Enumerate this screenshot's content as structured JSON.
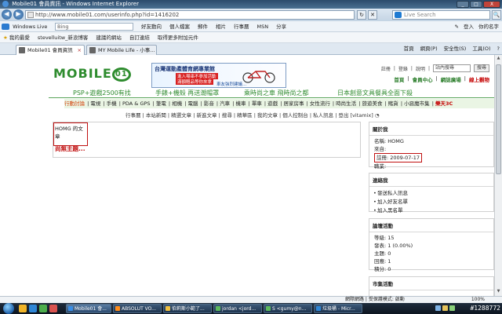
{
  "window": {
    "title": "Mobile01 會員資訊 - Windows Internet Explorer",
    "controls": [
      "_",
      "□",
      "X"
    ]
  },
  "address_bar": {
    "url": "http://www.mobile01.com/userinfo.php?id=1416202",
    "back": "◀",
    "forward": "▶",
    "refresh": "↻",
    "stop": "✕",
    "search_placeholder": "Live Search",
    "search_btn": "🔍"
  },
  "toolbar2": {
    "brand": "Windows Live",
    "bing": "Bing",
    "items": [
      "好友動向",
      "個人檔案",
      "郵件",
      "相片",
      "行事曆",
      "MSN",
      "分享"
    ],
    "right": [
      "✎",
      "登入",
      "你的名字"
    ]
  },
  "favorites": {
    "label": "我的最愛",
    "items": [
      "stevelluitw_新浪博客",
      "建議的網站",
      "自訂連結",
      "取得更多附加元件"
    ]
  },
  "tabs": [
    {
      "label": "Mobile01 會員資訊",
      "active": true
    },
    {
      "label": "MY Mobile Life - 小事...",
      "active": false
    }
  ],
  "tab_tools": [
    "首頁",
    "網頁(P)",
    "安全性(S)",
    "工具(O)",
    "?"
  ],
  "site": {
    "logo_text": "MOBILE",
    "logo_o1": "01",
    "banner": {
      "title": "台灣運動產體育網專業館",
      "red1": "進入場串不參加活動",
      "red2": "滿額贈品等你來拿",
      "blue": "車友強烈建議..."
    },
    "top_links": [
      "註冊",
      "登錄",
      "說明",
      "站內搜尋"
    ],
    "search_placeholder": "站內搜尋",
    "search_btn": "搜尋",
    "links2": [
      {
        "text": "首頁",
        "style": "grn"
      },
      {
        "text": "會員中心",
        "style": "grn"
      },
      {
        "text": "網誌廣場",
        "style": "grn"
      },
      {
        "text": "線上觀物",
        "style": "red"
      }
    ],
    "promos": [
      "PSP+遊戲2500有找",
      "手錶+機殼 再送潮帽罩",
      "乘時尚之車 飛時尚之都",
      "日本創意文具餐具全面下殺"
    ],
    "categories": [
      "行動討論",
      "電視",
      "手機",
      "PDA & GPS",
      "筆電",
      "相機",
      "電腦",
      "影音",
      "汽車",
      "機車",
      "單車",
      "遊戲",
      "居家房事",
      "女性流行",
      "時尚生活",
      "旅遊美食",
      "賭貨",
      "小惡魔市集"
    ],
    "category_right": "樂天3C",
    "subnav": [
      "行事曆",
      "本站新聞",
      "精選文章",
      "新進文章",
      "搜尋",
      "精華區",
      "我的文章",
      "個人控制台",
      "私人訊息",
      "登出 [vitamix]"
    ],
    "article_head": "HOMG 的文章",
    "no_topic": "尚無主題..."
  },
  "profile": {
    "title": "關於我",
    "name": "名稱: HOMG",
    "from": "來自:",
    "registered": "註冊: 2009-07-17",
    "status": "職業:"
  },
  "contact": {
    "title": "連絡我",
    "items": [
      "發送私人訊息",
      "加入好友名單",
      "加入黑名單"
    ]
  },
  "forum_activity": {
    "title": "論壇活動",
    "rows": [
      "等級: 15",
      "發表: 1 (0.00%)",
      "主題: 0",
      "回應: 1",
      "積分: 0"
    ]
  },
  "market_activity": {
    "title": "市集活動"
  },
  "status_bar": {
    "security": "網際網路 | 受保護模式: 啟動",
    "zoom": "100%"
  },
  "taskbar": {
    "buttons": [
      "Mobile01 會...",
      "ABSOLUT VO...",
      "伯莉斯小範了...",
      "jordan <jord...",
      "S <gumy@n...",
      "垃圾桶 - Micr..."
    ],
    "watermark": "#1288772"
  }
}
